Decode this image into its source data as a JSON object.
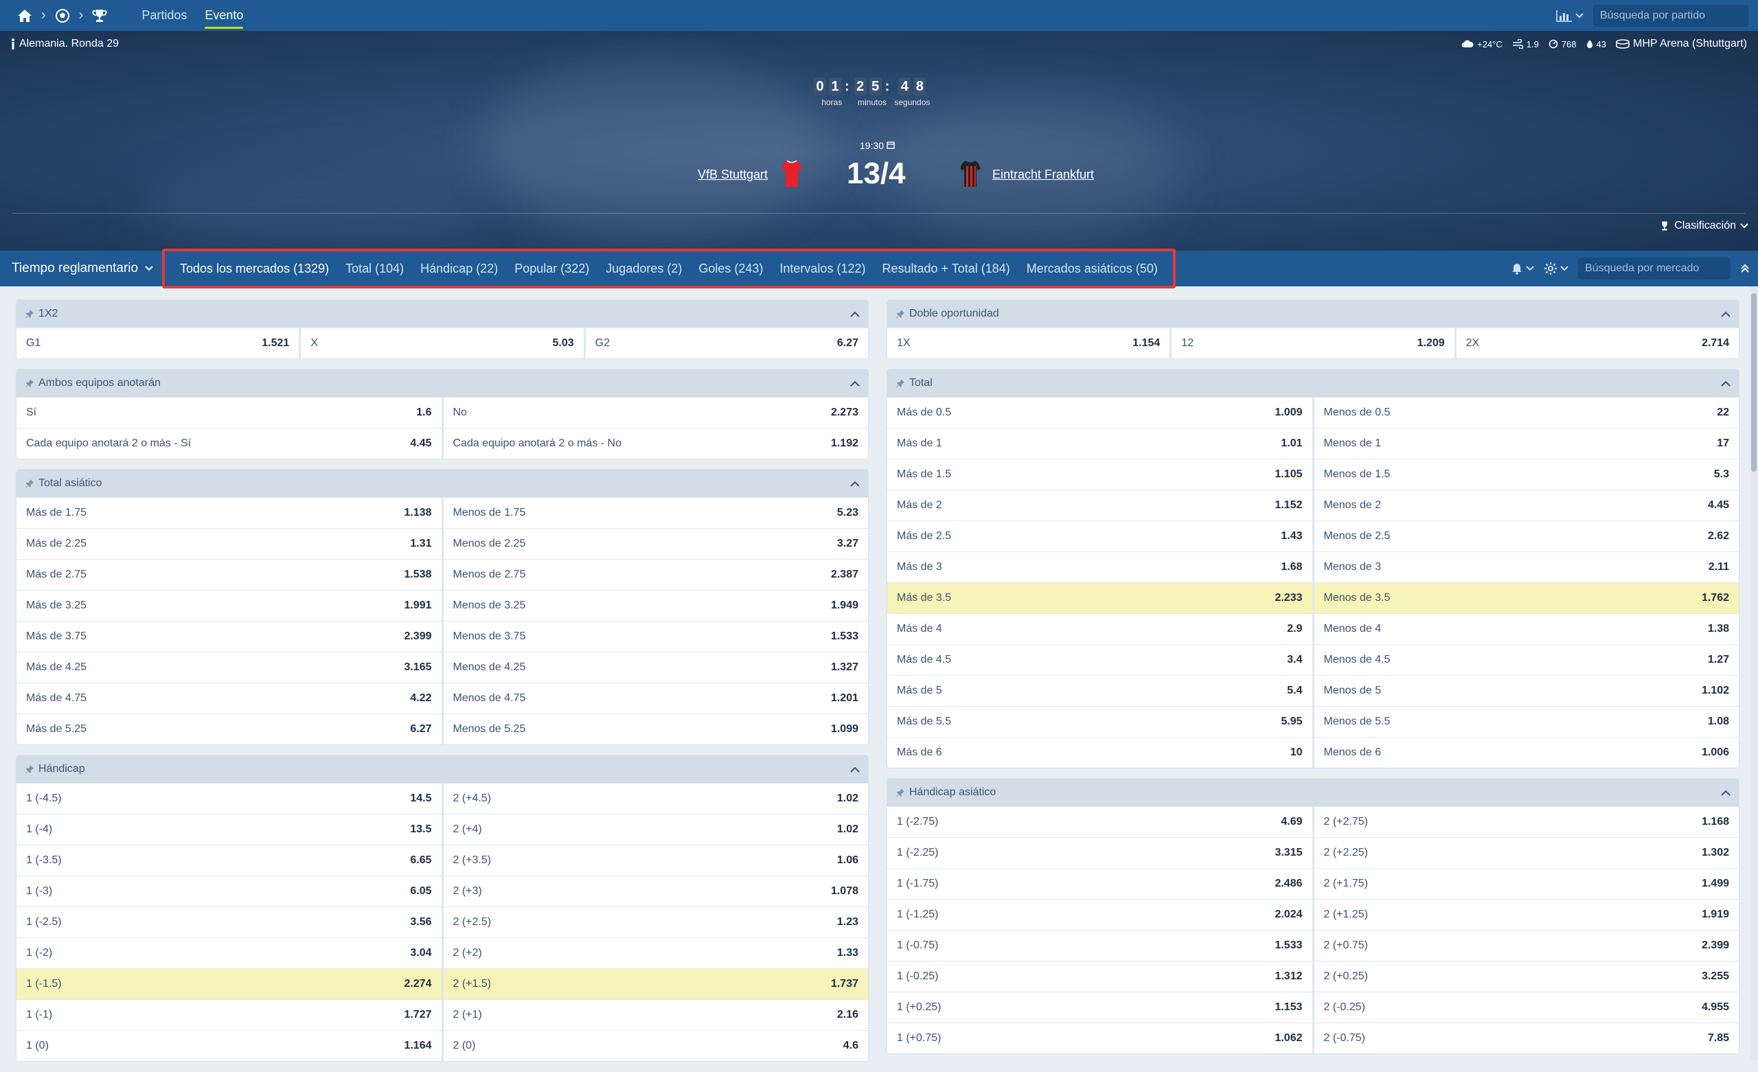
{
  "nav": {
    "links": [
      "Partidos",
      "Evento"
    ],
    "search_placeholder": "Búsqueda por partido"
  },
  "event": {
    "league": "Alemania. Ronda 29",
    "weather": {
      "temp": "+24°C",
      "wind": "1.9",
      "pressure": "768",
      "humidity": "43"
    },
    "venue": "MHP Arena (Shtuttgart)",
    "countdown": {
      "hours": [
        "0",
        "1"
      ],
      "minutes": [
        "2",
        "5"
      ],
      "seconds": [
        "4",
        "8"
      ],
      "labels": [
        "horas",
        "minutos",
        "segundos"
      ]
    },
    "team_home": "VfB Stuttgart",
    "team_away": "Eintracht Frankfurt",
    "kickoff": "19:30",
    "date": "13/4",
    "standings": "Clasificación"
  },
  "market_bar": {
    "period": "Tiempo reglamentario",
    "tabs": [
      "Todos los mercados (1329)",
      "Total (104)",
      "Hándicap (22)",
      "Popular (322)",
      "Jugadores (2)",
      "Goles (243)",
      "Intervalos (122)",
      "Resultado + Total (184)",
      "Mercados asiáticos (50)"
    ],
    "search_placeholder": "Búsqueda por mercado"
  },
  "markets_left": [
    {
      "title": "1X2",
      "cols": 3,
      "rows": [
        [
          [
            "G1",
            "1.521"
          ],
          [
            "X",
            "5.03"
          ],
          [
            "G2",
            "6.27"
          ]
        ]
      ]
    },
    {
      "title": "Ambos equipos anotarán",
      "cols": 2,
      "rows": [
        [
          [
            "Sí",
            "1.6"
          ],
          [
            "No",
            "2.273"
          ]
        ],
        [
          [
            "Cada equipo anotará 2 o más - Sí",
            "4.45"
          ],
          [
            "Cada equipo anotará 2 o más - No",
            "1.192"
          ]
        ]
      ]
    },
    {
      "title": "Total asiático",
      "cols": 2,
      "rows": [
        [
          [
            "Más de 1.75",
            "1.138"
          ],
          [
            "Menos de 1.75",
            "5.23"
          ]
        ],
        [
          [
            "Más de 2.25",
            "1.31"
          ],
          [
            "Menos de 2.25",
            "3.27"
          ]
        ],
        [
          [
            "Más de 2.75",
            "1.538"
          ],
          [
            "Menos de 2.75",
            "2.387"
          ]
        ],
        [
          [
            "Más de 3.25",
            "1.991"
          ],
          [
            "Menos de 3.25",
            "1.949"
          ]
        ],
        [
          [
            "Más de 3.75",
            "2.399"
          ],
          [
            "Menos de 3.75",
            "1.533"
          ]
        ],
        [
          [
            "Más de 4.25",
            "3.165"
          ],
          [
            "Menos de 4.25",
            "1.327"
          ]
        ],
        [
          [
            "Más de 4.75",
            "4.22"
          ],
          [
            "Menos de 4.75",
            "1.201"
          ]
        ],
        [
          [
            "Más de 5.25",
            "6.27"
          ],
          [
            "Menos de 5.25",
            "1.099"
          ]
        ]
      ]
    },
    {
      "title": "Hándicap",
      "cols": 2,
      "highlight": 6,
      "rows": [
        [
          [
            "1 (-4.5)",
            "14.5"
          ],
          [
            "2 (+4.5)",
            "1.02"
          ]
        ],
        [
          [
            "1 (-4)",
            "13.5"
          ],
          [
            "2 (+4)",
            "1.02"
          ]
        ],
        [
          [
            "1 (-3.5)",
            "6.65"
          ],
          [
            "2 (+3.5)",
            "1.06"
          ]
        ],
        [
          [
            "1 (-3)",
            "6.05"
          ],
          [
            "2 (+3)",
            "1.078"
          ]
        ],
        [
          [
            "1 (-2.5)",
            "3.56"
          ],
          [
            "2 (+2.5)",
            "1.23"
          ]
        ],
        [
          [
            "1 (-2)",
            "3.04"
          ],
          [
            "2 (+2)",
            "1.33"
          ]
        ],
        [
          [
            "1 (-1.5)",
            "2.274"
          ],
          [
            "2 (+1.5)",
            "1.737"
          ]
        ],
        [
          [
            "1 (-1)",
            "1.727"
          ],
          [
            "2 (+1)",
            "2.16"
          ]
        ],
        [
          [
            "1 (0)",
            "1.164"
          ],
          [
            "2 (0)",
            "4.6"
          ]
        ]
      ]
    }
  ],
  "markets_right": [
    {
      "title": "Doble oportunidad",
      "cols": 3,
      "rows": [
        [
          [
            "1X",
            "1.154"
          ],
          [
            "12",
            "1.209"
          ],
          [
            "2X",
            "2.714"
          ]
        ]
      ]
    },
    {
      "title": "Total",
      "cols": 2,
      "highlight": 6,
      "rows": [
        [
          [
            "Más de 0.5",
            "1.009"
          ],
          [
            "Menos de 0.5",
            "22"
          ]
        ],
        [
          [
            "Más de 1",
            "1.01"
          ],
          [
            "Menos de 1",
            "17"
          ]
        ],
        [
          [
            "Más de 1.5",
            "1.105"
          ],
          [
            "Menos de 1.5",
            "5.3"
          ]
        ],
        [
          [
            "Más de 2",
            "1.152"
          ],
          [
            "Menos de 2",
            "4.45"
          ]
        ],
        [
          [
            "Más de 2.5",
            "1.43"
          ],
          [
            "Menos de 2.5",
            "2.62"
          ]
        ],
        [
          [
            "Más de 3",
            "1.68"
          ],
          [
            "Menos de 3",
            "2.11"
          ]
        ],
        [
          [
            "Más de 3.5",
            "2.233"
          ],
          [
            "Menos de 3.5",
            "1.762"
          ]
        ],
        [
          [
            "Más de 4",
            "2.9"
          ],
          [
            "Menos de 4",
            "1.38"
          ]
        ],
        [
          [
            "Más de 4.5",
            "3.4"
          ],
          [
            "Menos de 4.5",
            "1.27"
          ]
        ],
        [
          [
            "Más de 5",
            "5.4"
          ],
          [
            "Menos de 5",
            "1.102"
          ]
        ],
        [
          [
            "Más de 5.5",
            "5.95"
          ],
          [
            "Menos de 5.5",
            "1.08"
          ]
        ],
        [
          [
            "Más de 6",
            "10"
          ],
          [
            "Menos de 6",
            "1.006"
          ]
        ]
      ]
    },
    {
      "title": "Hándicap asiático",
      "cols": 2,
      "rows": [
        [
          [
            "1 (-2.75)",
            "4.69"
          ],
          [
            "2 (+2.75)",
            "1.168"
          ]
        ],
        [
          [
            "1 (-2.25)",
            "3.315"
          ],
          [
            "2 (+2.25)",
            "1.302"
          ]
        ],
        [
          [
            "1 (-1.75)",
            "2.486"
          ],
          [
            "2 (+1.75)",
            "1.499"
          ]
        ],
        [
          [
            "1 (-1.25)",
            "2.024"
          ],
          [
            "2 (+1.25)",
            "1.919"
          ]
        ],
        [
          [
            "1 (-0.75)",
            "1.533"
          ],
          [
            "2 (+0.75)",
            "2.399"
          ]
        ],
        [
          [
            "1 (-0.25)",
            "1.312"
          ],
          [
            "2 (+0.25)",
            "3.255"
          ]
        ],
        [
          [
            "1 (+0.25)",
            "1.153"
          ],
          [
            "2 (-0.25)",
            "4.955"
          ]
        ],
        [
          [
            "1 (+0.75)",
            "1.062"
          ],
          [
            "2 (-0.75)",
            "7.85"
          ]
        ]
      ]
    }
  ],
  "colors": {
    "primary": "#1f5a94",
    "highlight": "#f6f4b8",
    "tab_outline": "#e53935"
  }
}
